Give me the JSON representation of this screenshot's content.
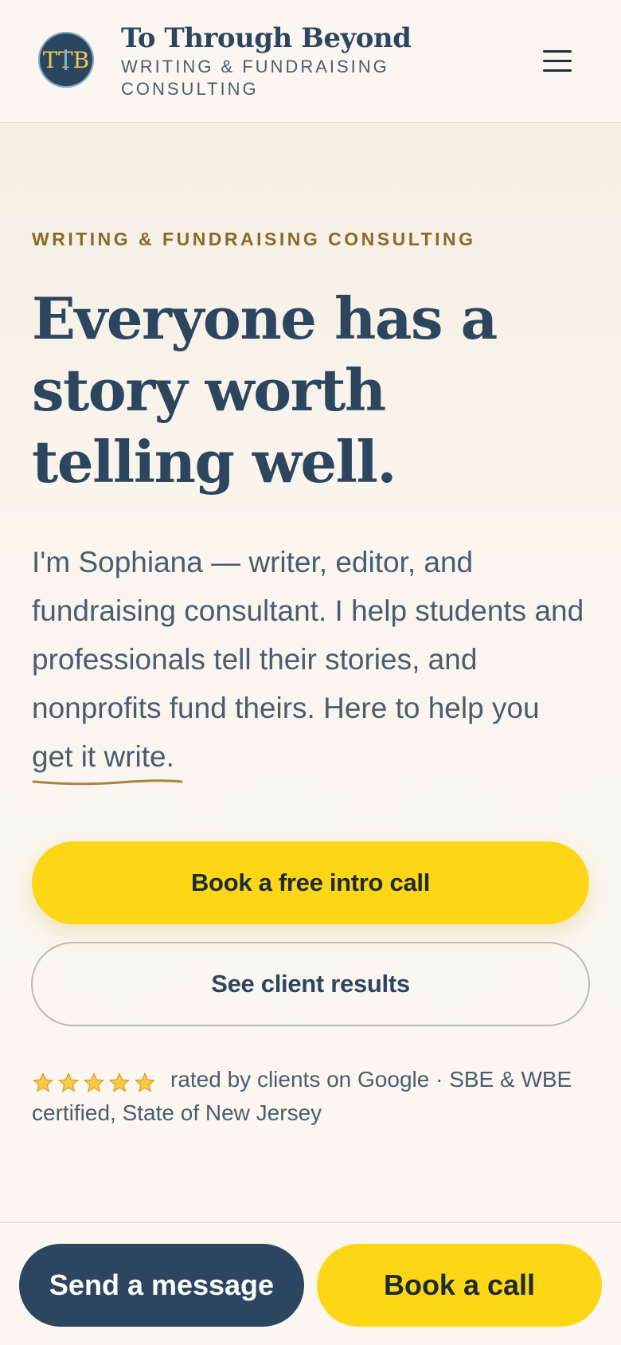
{
  "header": {
    "logo_initials": "TTB",
    "brand_name": "To Through Beyond",
    "tagline": "Writing & Fundraising Consulting",
    "menu_icon": "hamburger-menu-icon"
  },
  "hero": {
    "eyebrow": "Writing & Fundraising Consulting",
    "headline": "Everyone has a story worth telling well.",
    "intro_prefix": "I'm Sophiana — writer, editor, and fundraising consultant. I help students and professionals tell their stories, and nonprofits fund theirs. Here to help you ",
    "intro_highlight": "get it write",
    "intro_suffix": ".",
    "primary_cta": "Book a free intro call",
    "secondary_cta": "See client results",
    "star_count": 5,
    "rating_text": "rated by clients on Google · SBE & WBE certified, State of New Jersey"
  },
  "bottom_bar": {
    "message_button": "Send a message",
    "call_button": "Book a call"
  },
  "colors": {
    "navy": "#2d4660",
    "yellow": "#fdd716",
    "gold": "#8a6a2a",
    "background": "#fbf7f0"
  }
}
